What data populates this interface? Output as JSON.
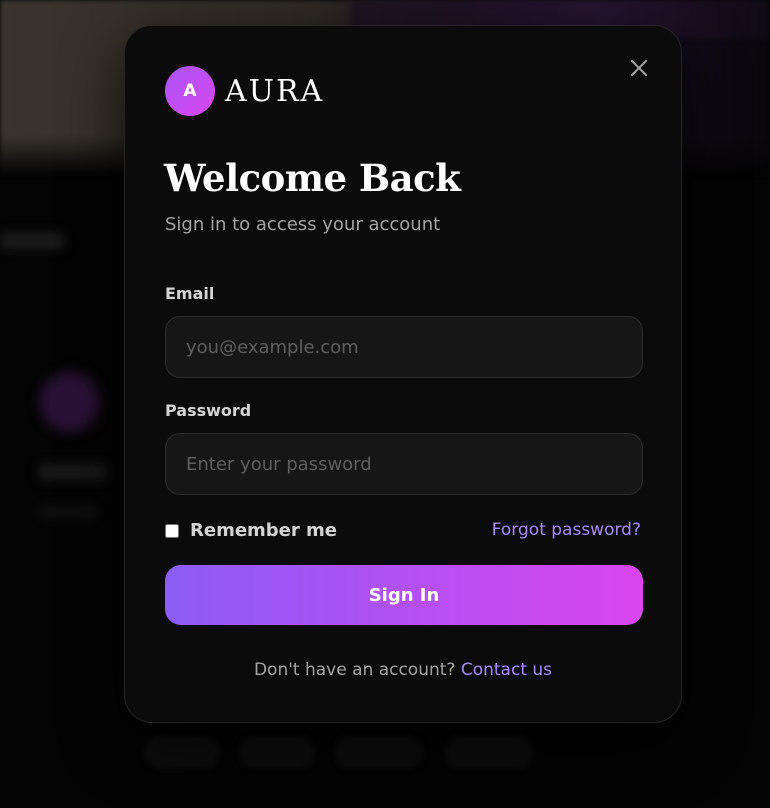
{
  "brand": {
    "logo_letter": "A",
    "name": "AURA"
  },
  "modal": {
    "title": "Welcome Back",
    "subtitle": "Sign in to access your account"
  },
  "form": {
    "email_label": "Email",
    "email_value": "",
    "email_placeholder": "you@example.com",
    "password_label": "Password",
    "password_value": "",
    "password_placeholder": "Enter your password",
    "remember_label": "Remember me",
    "remember_checked": false,
    "forgot_link": "Forgot password?",
    "submit_label": "Sign In"
  },
  "footer": {
    "prompt": "Don't have an account?",
    "contact_link": "Contact us"
  },
  "icons": {
    "close": "close-icon",
    "logo": "logo-badge-icon"
  },
  "colors": {
    "accent_start": "#8b5cf6",
    "accent_end": "#d946ef",
    "link": "#a78bfa",
    "modal_bg": "#0b0b0b",
    "field_bg": "#161616"
  }
}
